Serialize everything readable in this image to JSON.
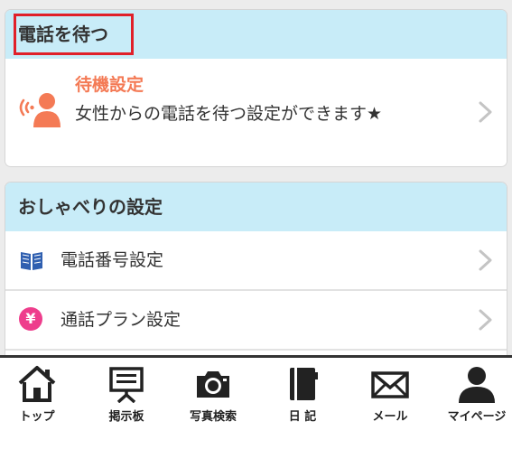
{
  "colors": {
    "header_bg": "#c8ecf8",
    "accent_orange": "#f47a55",
    "highlight_red": "#e0202a",
    "book_blue": "#2f5fb0",
    "yen_pink": "#ee3d8c"
  },
  "card_waiting": {
    "title": "電話を待つ",
    "item": {
      "icon": "person-calling-icon",
      "title": "待機設定",
      "subtitle": "女性からの電話を待つ設定ができます★"
    }
  },
  "card_talk": {
    "title": "おしゃべりの設定",
    "items": [
      {
        "icon": "book-icon",
        "label": "電話番号設定"
      },
      {
        "icon": "yen-icon",
        "icon_text": "¥",
        "label": "通話プラン設定"
      }
    ]
  },
  "tabbar": {
    "tabs": [
      {
        "icon": "home-icon",
        "label": "トップ"
      },
      {
        "icon": "board-icon",
        "label": "掲示板"
      },
      {
        "icon": "camera-icon",
        "label": "写真検索"
      },
      {
        "icon": "diary-icon",
        "label": "日 記"
      },
      {
        "icon": "mail-icon",
        "label": "メール"
      },
      {
        "icon": "user-icon",
        "label": "マイページ"
      }
    ]
  }
}
